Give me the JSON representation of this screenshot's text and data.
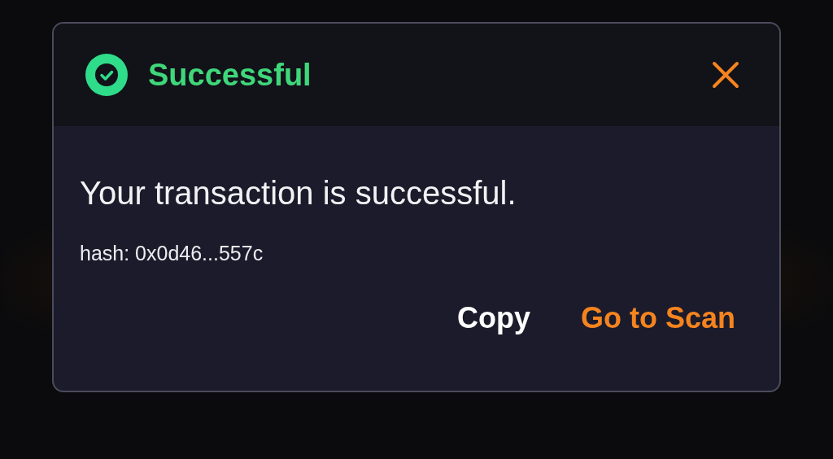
{
  "dialog": {
    "kind": "success",
    "title": "Successful",
    "message": "Your transaction is successful.",
    "hash": "hash: 0x0d46...557c",
    "buttons": [
      {
        "label": "Copy",
        "kind": "secondary"
      },
      {
        "label": "Go to Scan",
        "kind": "primary"
      }
    ]
  }
}
